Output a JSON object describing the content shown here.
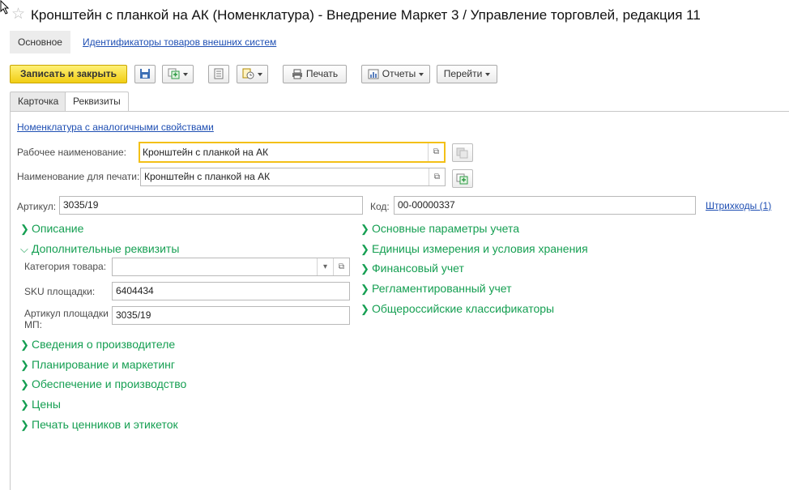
{
  "window": {
    "title": "Кронштейн с планкой на АК (Номенклатура) - Внедрение Маркет 3 / Управление торговлей, редакция 11"
  },
  "nav": {
    "main": "Основное",
    "link": "Идентификаторы товаров внешних систем"
  },
  "toolbar": {
    "save_close": "Записать и закрыть",
    "print": "Печать",
    "reports": "Отчеты",
    "goto": "Перейти"
  },
  "tabs": {
    "card": "Карточка",
    "props": "Реквизиты"
  },
  "form": {
    "similar_link": "Номенклатура с аналогичными свойствами",
    "work_name_label": "Рабочее наименование:",
    "work_name_value": "Кронштейн с планкой на АК",
    "print_name_label": "Наименование для печати:",
    "print_name_value": "Кронштейн с планкой на АК",
    "article_label": "Артикул:",
    "article_value": "3035/19",
    "code_label": "Код:",
    "code_value": "00-00000337",
    "barcodes_link": "Штрихкоды (1)"
  },
  "left_groups": {
    "description": "Описание",
    "additional": "Дополнительные реквизиты",
    "manufacturer": "Сведения о производителе",
    "planning": "Планирование и маркетинг",
    "supply": "Обеспечение и производство",
    "prices": "Цены",
    "labels": "Печать ценников и этикеток"
  },
  "additional_fields": {
    "category_label": "Категория товара:",
    "category_value": "",
    "sku_label": "SKU площадки:",
    "sku_value": "6404434",
    "mp_article_label": "Артикул площадки МП:",
    "mp_article_value": "3035/19"
  },
  "right_groups": {
    "basic_params": "Основные параметры учета",
    "units": "Единицы измерения и условия хранения",
    "finance": "Финансовый учет",
    "regulated": "Регламентированный учет",
    "classifiers": "Общероссийские классификаторы"
  },
  "colors": {
    "accent_yellow": "#f1cd14",
    "group_green": "#159f52",
    "link_blue": "#1f4fb3"
  }
}
